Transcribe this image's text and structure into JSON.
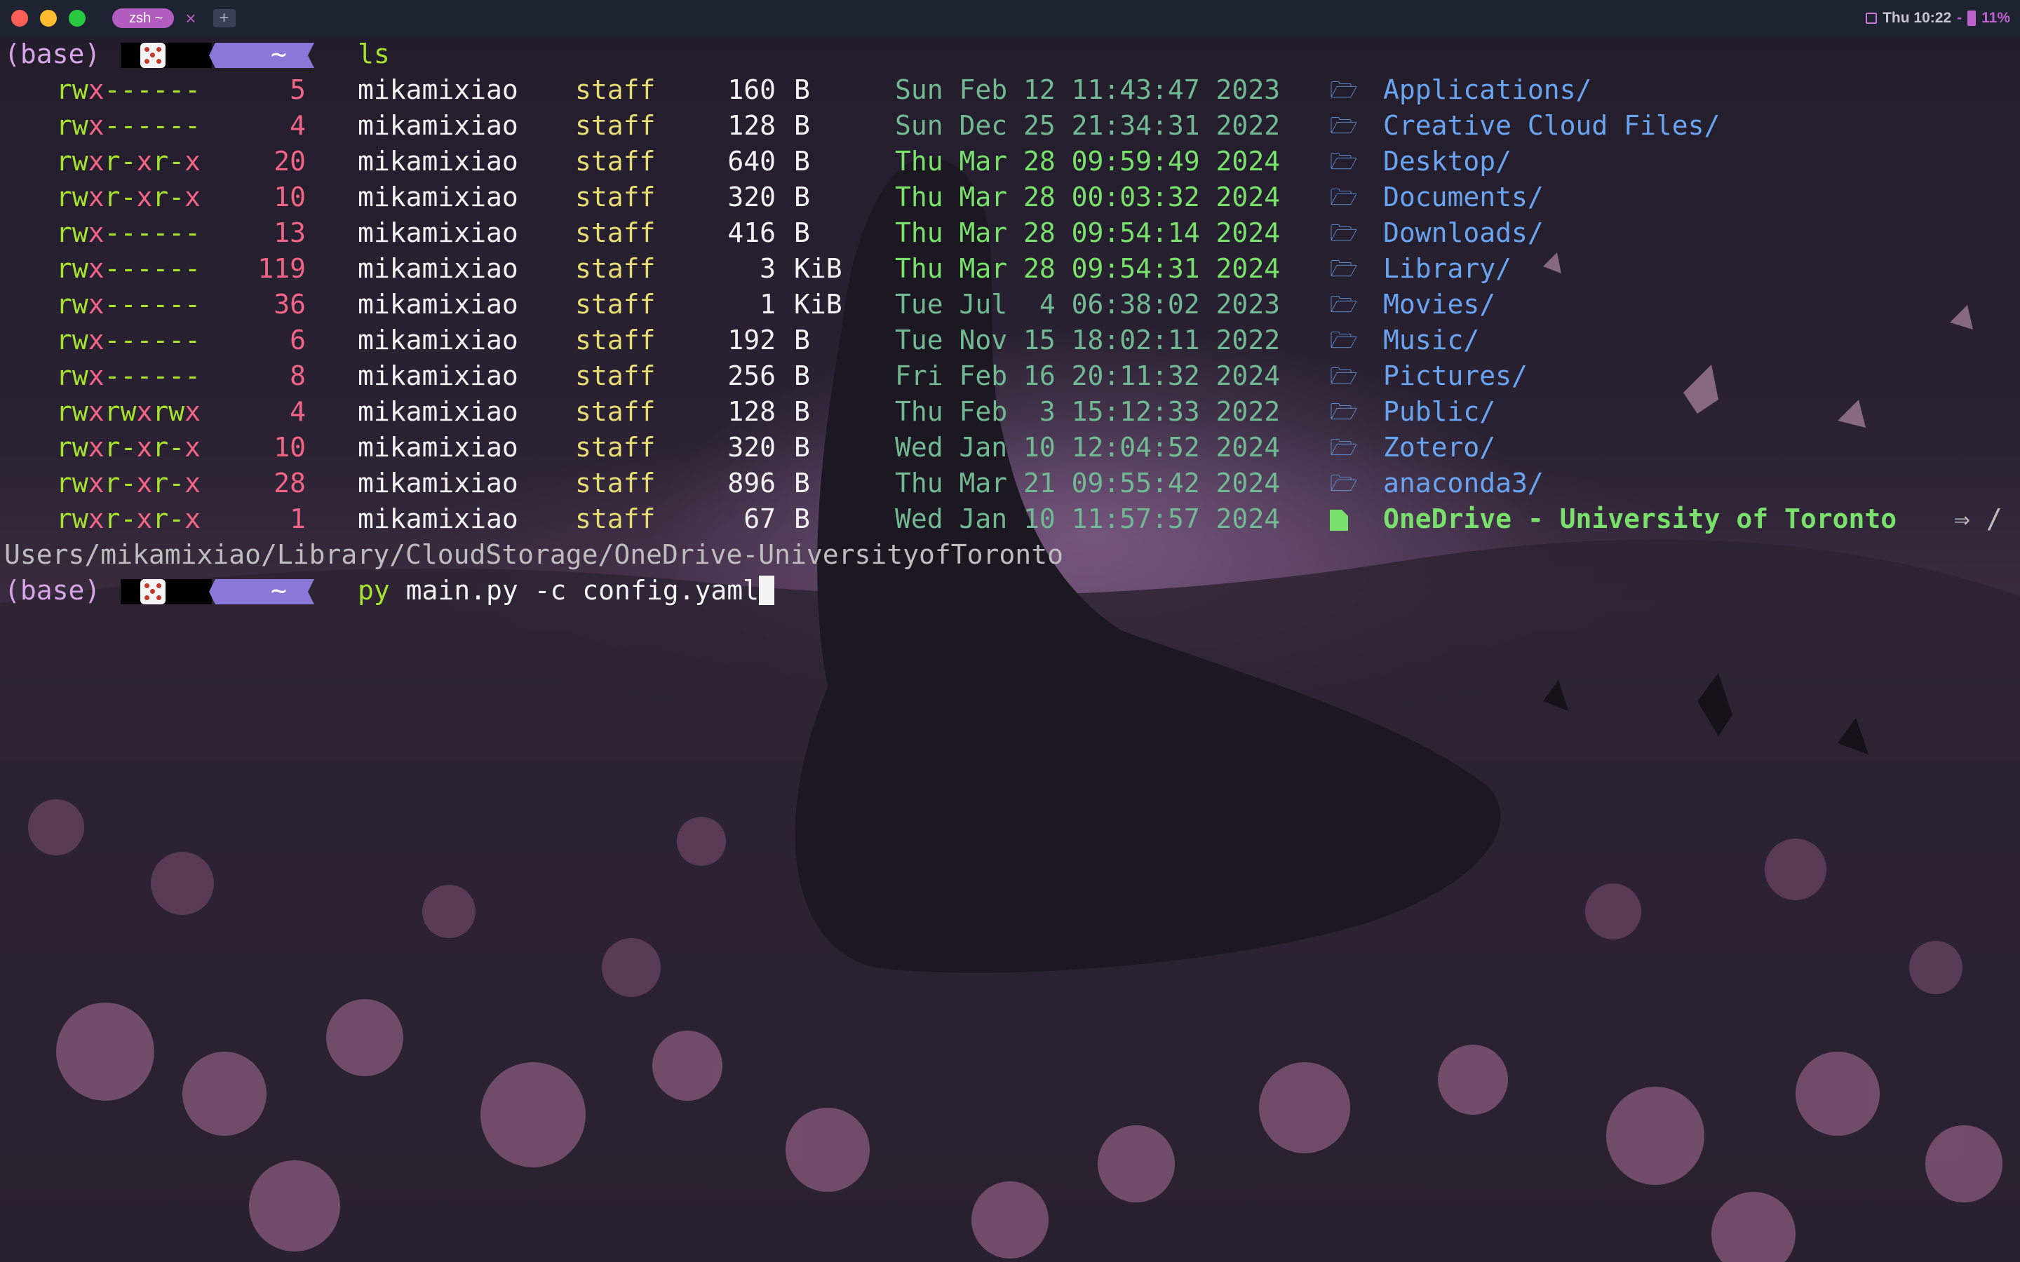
{
  "titlebar": {
    "tab_label": "zsh ~",
    "tab_close": "×",
    "tab_add": "+",
    "status_clock": "Thu 10:22",
    "status_sep": "-",
    "battery": "11%"
  },
  "colors": {
    "accent": "#b45dc0",
    "dir": "#6aa4f0",
    "date_recent": "#79e06b",
    "date_older": "#72b893",
    "perm_x": "#f06586",
    "perm_rw": "#a6e22e"
  },
  "prompt": {
    "env": "(base)",
    "dir": "~",
    "icon": "dice-icon"
  },
  "commands": {
    "first": "ls",
    "second_cmd": "py",
    "second_args": " main.py -c config.yaml"
  },
  "listing": [
    {
      "perm": [
        "r",
        "w",
        "x",
        "-",
        "-",
        "-",
        "-",
        "-",
        "-"
      ],
      "links": "5",
      "user": "mikamixiao",
      "group": "staff",
      "size": "160",
      "unit": "B",
      "date": "Sun Feb 12 11:43:47 2023",
      "recent": false,
      "name": "Applications/"
    },
    {
      "perm": [
        "r",
        "w",
        "x",
        "-",
        "-",
        "-",
        "-",
        "-",
        "-"
      ],
      "links": "4",
      "user": "mikamixiao",
      "group": "staff",
      "size": "128",
      "unit": "B",
      "date": "Sun Dec 25 21:34:31 2022",
      "recent": false,
      "name": "Creative Cloud Files/"
    },
    {
      "perm": [
        "r",
        "w",
        "x",
        "r",
        "-",
        "x",
        "r",
        "-",
        "x"
      ],
      "links": "20",
      "user": "mikamixiao",
      "group": "staff",
      "size": "640",
      "unit": "B",
      "date": "Thu Mar 28 09:59:49 2024",
      "recent": true,
      "name": "Desktop/"
    },
    {
      "perm": [
        "r",
        "w",
        "x",
        "r",
        "-",
        "x",
        "r",
        "-",
        "x"
      ],
      "links": "10",
      "user": "mikamixiao",
      "group": "staff",
      "size": "320",
      "unit": "B",
      "date": "Thu Mar 28 00:03:32 2024",
      "recent": true,
      "name": "Documents/"
    },
    {
      "perm": [
        "r",
        "w",
        "x",
        "-",
        "-",
        "-",
        "-",
        "-",
        "-"
      ],
      "links": "13",
      "user": "mikamixiao",
      "group": "staff",
      "size": "416",
      "unit": "B",
      "date": "Thu Mar 28 09:54:14 2024",
      "recent": true,
      "name": "Downloads/"
    },
    {
      "perm": [
        "r",
        "w",
        "x",
        "-",
        "-",
        "-",
        "-",
        "-",
        "-"
      ],
      "links": "119",
      "user": "mikamixiao",
      "group": "staff",
      "size": "3",
      "unit": "KiB",
      "date": "Thu Mar 28 09:54:31 2024",
      "recent": true,
      "name": "Library/"
    },
    {
      "perm": [
        "r",
        "w",
        "x",
        "-",
        "-",
        "-",
        "-",
        "-",
        "-"
      ],
      "links": "36",
      "user": "mikamixiao",
      "group": "staff",
      "size": "1",
      "unit": "KiB",
      "date": "Tue Jul  4 06:38:02 2023",
      "recent": false,
      "name": "Movies/"
    },
    {
      "perm": [
        "r",
        "w",
        "x",
        "-",
        "-",
        "-",
        "-",
        "-",
        "-"
      ],
      "links": "6",
      "user": "mikamixiao",
      "group": "staff",
      "size": "192",
      "unit": "B",
      "date": "Tue Nov 15 18:02:11 2022",
      "recent": false,
      "name": "Music/"
    },
    {
      "perm": [
        "r",
        "w",
        "x",
        "-",
        "-",
        "-",
        "-",
        "-",
        "-"
      ],
      "links": "8",
      "user": "mikamixiao",
      "group": "staff",
      "size": "256",
      "unit": "B",
      "date": "Fri Feb 16 20:11:32 2024",
      "recent": false,
      "name": "Pictures/"
    },
    {
      "perm": [
        "r",
        "w",
        "x",
        "r",
        "w",
        "x",
        "r",
        "w",
        "x"
      ],
      "links": "4",
      "user": "mikamixiao",
      "group": "staff",
      "size": "128",
      "unit": "B",
      "date": "Thu Feb  3 15:12:33 2022",
      "recent": false,
      "name": "Public/"
    },
    {
      "perm": [
        "r",
        "w",
        "x",
        "r",
        "-",
        "x",
        "r",
        "-",
        "x"
      ],
      "links": "10",
      "user": "mikamixiao",
      "group": "staff",
      "size": "320",
      "unit": "B",
      "date": "Wed Jan 10 12:04:52 2024",
      "recent": false,
      "name": "Zotero/"
    },
    {
      "perm": [
        "r",
        "w",
        "x",
        "r",
        "-",
        "x",
        "r",
        "-",
        "x"
      ],
      "links": "28",
      "user": "mikamixiao",
      "group": "staff",
      "size": "896",
      "unit": "B",
      "date": "Thu Mar 21 09:55:42 2024",
      "recent": false,
      "name": "anaconda3/"
    },
    {
      "perm": [
        "r",
        "w",
        "x",
        "r",
        "-",
        "x",
        "r",
        "-",
        "x"
      ],
      "links": "1",
      "user": "mikamixiao",
      "group": "staff",
      "size": "67",
      "unit": "B",
      "date": "Wed Jan 10 11:57:57 2024",
      "recent": false,
      "name": "OneDrive - University of Toronto",
      "symlink": true,
      "arrow": "⇒ /"
    }
  ],
  "symlink_target_wrap": "Users/mikamixiao/Library/CloudStorage/OneDrive-UniversityofToronto"
}
